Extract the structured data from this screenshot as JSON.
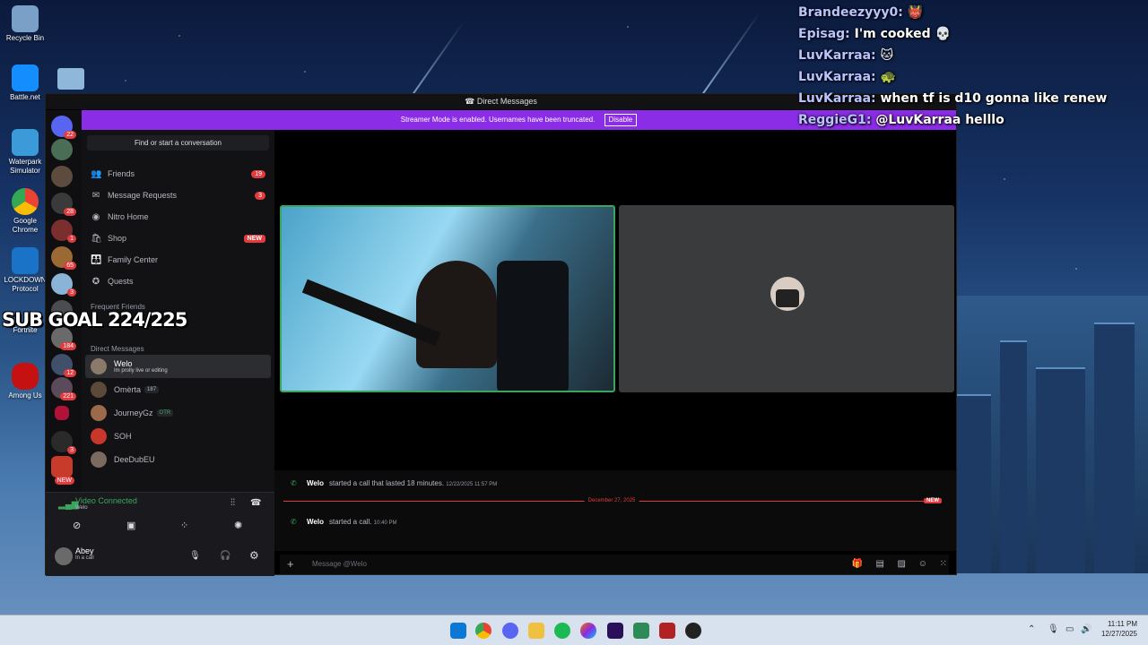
{
  "desktop": {
    "icons": [
      {
        "label": "Recycle Bin",
        "color": "#7aa0c8"
      },
      {
        "label": "Battle.net",
        "color": "#148eff"
      },
      {
        "label": "Waterpark Simulator",
        "color": "#3a9bd8"
      },
      {
        "label": "Google Chrome",
        "color": "#e8453c"
      },
      {
        "label": "LOCKDOWN Protocol",
        "color": "#1a73c6"
      },
      {
        "label": "Fortnite",
        "color": "#6a4fb0"
      },
      {
        "label": "Among Us",
        "color": "#c51111"
      }
    ]
  },
  "overlay": {
    "sub_goal": "SUB GOAL 224/225",
    "chat": [
      {
        "name": "Brandeezyyy0:",
        "text": "👹"
      },
      {
        "name": "Episag:",
        "text": "I'm cooked 💀"
      },
      {
        "name": "LuvKarraa:",
        "text": "🐱"
      },
      {
        "name": "LuvKarraa:",
        "text": "🐢"
      },
      {
        "name": "LuvKarraa:",
        "text": "when tf is d10 gonna like renew"
      },
      {
        "name": "ReggieG1:",
        "text": "@LuvKarraa helllo"
      }
    ]
  },
  "window": {
    "title": "Direct Messages",
    "streamer_banner": "Streamer Mode is enabled. Usernames have been truncated.",
    "disable_label": "Disable"
  },
  "guild_badges": [
    "22",
    "",
    "",
    "28",
    "1",
    "65",
    "3",
    "",
    "184",
    "12",
    "221",
    "",
    "3",
    "",
    "NEW"
  ],
  "sidebar": {
    "find": "Find or start a conversation",
    "nav": [
      {
        "icon": "friends-icon",
        "glyph": "👥",
        "label": "Friends",
        "count": "19"
      },
      {
        "icon": "mail-icon",
        "glyph": "✉",
        "label": "Message Requests",
        "count": "3"
      },
      {
        "icon": "nitro-icon",
        "glyph": "◉",
        "label": "Nitro Home",
        "count": ""
      },
      {
        "icon": "shop-icon",
        "glyph": "🛍",
        "label": "Shop",
        "badge": "NEW"
      },
      {
        "icon": "family-icon",
        "glyph": "👪",
        "label": "Family Center",
        "count": ""
      },
      {
        "icon": "quests-icon",
        "glyph": "✪",
        "label": "Quests",
        "count": ""
      }
    ],
    "frequent_friends": "Frequent Friends",
    "direct_messages": "Direct Messages",
    "dms": [
      {
        "name": "Welo",
        "sub": "Im prolly live or editing",
        "tag": ""
      },
      {
        "name": "Omèrta",
        "sub": "",
        "tag": "187"
      },
      {
        "name": "JourneyGz",
        "sub": "",
        "tag": "OTR"
      },
      {
        "name": "SOH",
        "sub": "",
        "tag": ""
      },
      {
        "name": "DeeDubEU",
        "sub": "",
        "tag": ""
      }
    ]
  },
  "voice": {
    "status": "Video Connected",
    "channel": "Welo"
  },
  "user": {
    "name": "Abey",
    "status": "In a call"
  },
  "messages": [
    {
      "user": "Welo",
      "text": "started a call that lasted 18 minutes.",
      "time": "12/22/2025 11:57 PM"
    },
    {
      "user": "Welo",
      "text": "started a call.",
      "time": "10:40 PM"
    }
  ],
  "divider": {
    "date": "December 27, 2025",
    "new": "NEW"
  },
  "composer": {
    "placeholder": "Message @Welo"
  },
  "taskbar": {
    "time": "11:11 PM",
    "date": "12/27/2025"
  }
}
